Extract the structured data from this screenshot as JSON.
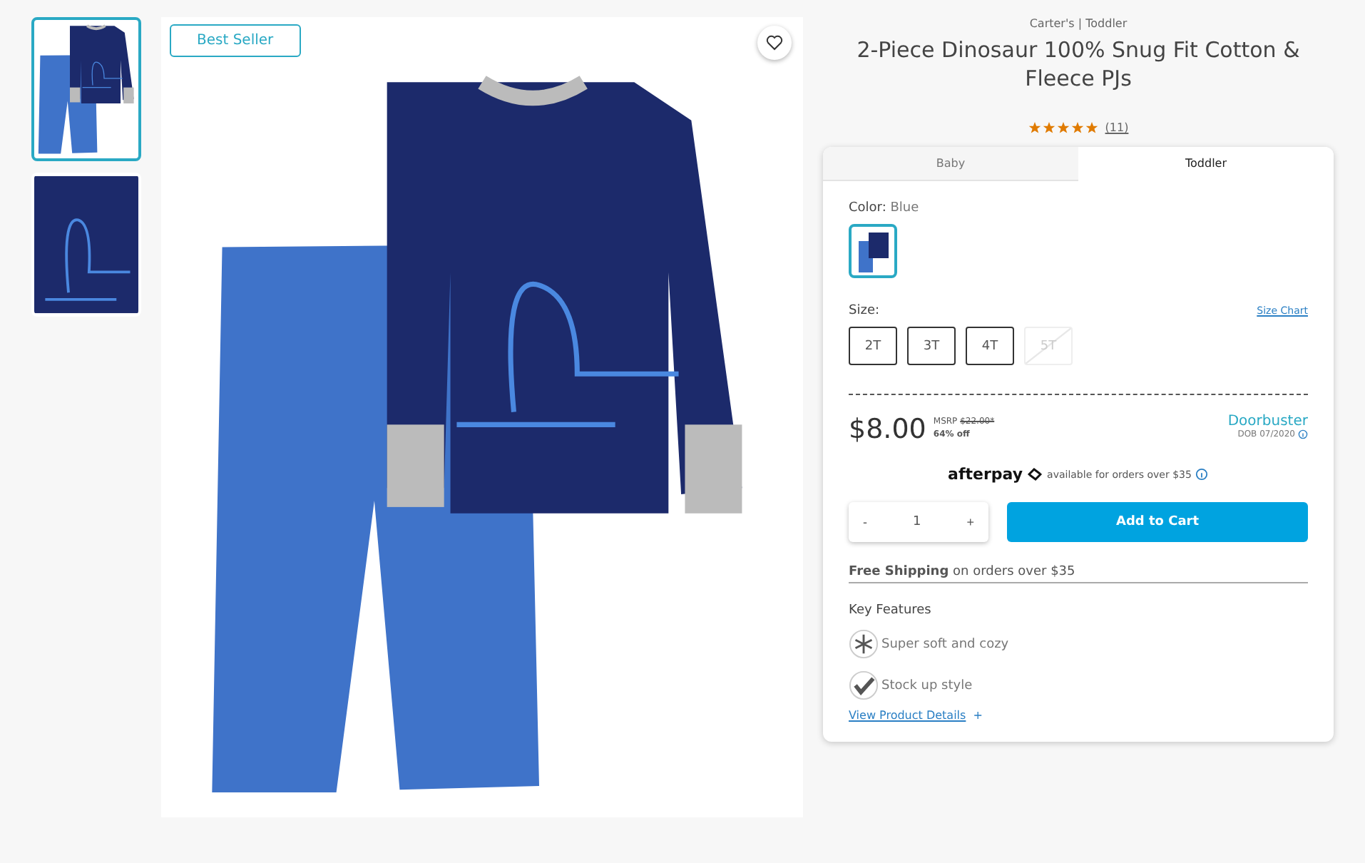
{
  "thumbnails": [
    {
      "selected": true,
      "kind": "outfit"
    },
    {
      "selected": false,
      "kind": "detail"
    }
  ],
  "badge": "Best Seller",
  "product": {
    "brand": "Carter's | Toddler",
    "title": "2-Piece Dinosaur 100% Snug Fit Cotton & Fleece PJs",
    "stars": 5,
    "reviews": "(11)"
  },
  "tabs": [
    {
      "label": "Baby",
      "selected": false
    },
    {
      "label": "Toddler",
      "selected": true
    }
  ],
  "color": {
    "label": "Color:",
    "value": "Blue",
    "swatches": [
      {
        "selected": true
      }
    ]
  },
  "size": {
    "label": "Size:",
    "chart_link": "Size Chart",
    "options": [
      {
        "label": "2T",
        "disabled": false
      },
      {
        "label": "3T",
        "disabled": false
      },
      {
        "label": "4T",
        "disabled": false
      },
      {
        "label": "5T",
        "disabled": true
      }
    ]
  },
  "price": {
    "current": "$8.00",
    "msrp_label": "MSRP",
    "msrp": "$22.00*",
    "discount": "64% off",
    "promo": "Doorbuster",
    "promo_note": "DOB 07/2020"
  },
  "afterpay": {
    "logo": "afterpay",
    "text": "available for orders over $35"
  },
  "quantity": {
    "minus": "-",
    "value": "1",
    "plus": "+"
  },
  "add_to_cart": "Add to Cart",
  "shipping": {
    "bold": "Free Shipping",
    "text": "on orders over $35"
  },
  "features": {
    "title": "Key Features",
    "items": [
      {
        "kind": "snowflake",
        "label": "Super soft and cozy"
      },
      {
        "kind": "check",
        "label": "Stock up style"
      }
    ]
  },
  "details_link": {
    "label": "View Product Details",
    "plus": "+"
  }
}
